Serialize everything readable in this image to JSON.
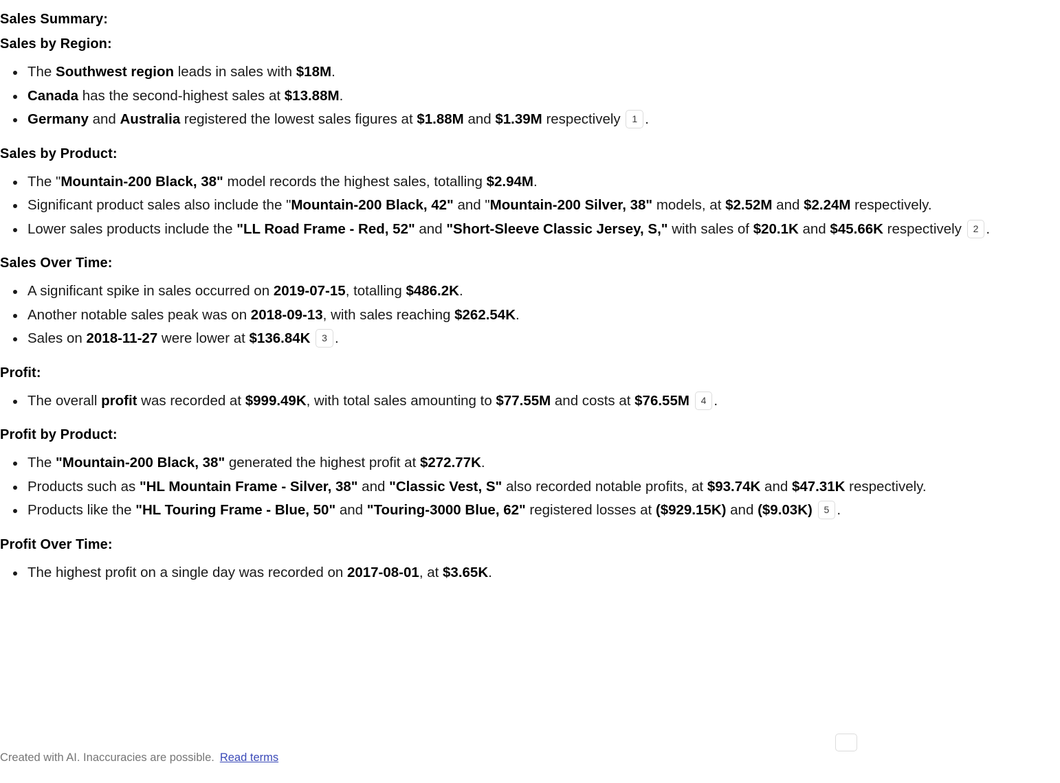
{
  "document": {
    "title": "Sales Summary:",
    "sections": [
      {
        "id": "sales-by-region",
        "heading": "Sales by Region:",
        "bullets": [
          {
            "id": "region-southwest",
            "parts": [
              {
                "t": "The ",
                "b": false
              },
              {
                "t": "Southwest region",
                "b": true
              },
              {
                "t": " leads in sales with ",
                "b": false
              },
              {
                "t": "$18M",
                "b": true
              },
              {
                "t": ".",
                "b": false
              }
            ]
          },
          {
            "id": "region-canada",
            "parts": [
              {
                "t": "Canada",
                "b": true
              },
              {
                "t": " has the second-highest sales at ",
                "b": false
              },
              {
                "t": "$13.88M",
                "b": true
              },
              {
                "t": ".",
                "b": false
              }
            ]
          },
          {
            "id": "region-germany-australia",
            "parts": [
              {
                "t": "Germany",
                "b": true
              },
              {
                "t": " and ",
                "b": false
              },
              {
                "t": "Australia",
                "b": true
              },
              {
                "t": " registered the lowest sales figures at ",
                "b": false
              },
              {
                "t": "$1.88M",
                "b": true
              },
              {
                "t": " and ",
                "b": false
              },
              {
                "t": "$1.39M",
                "b": true
              },
              {
                "t": " respectively ",
                "b": false
              },
              {
                "cite": "1"
              },
              {
                "t": ".",
                "b": false
              }
            ]
          }
        ]
      },
      {
        "id": "sales-by-product",
        "heading": "Sales by Product:",
        "bullets": [
          {
            "id": "product-top-seller",
            "parts": [
              {
                "t": "The ",
                "b": false
              },
              {
                "t": "\"",
                "b": false
              },
              {
                "t": "Mountain-200 Black, 38\"",
                "b": true
              },
              {
                "t": " model records the highest sales, totalling ",
                "b": false
              },
              {
                "t": "$2.94M",
                "b": true
              },
              {
                "t": ".",
                "b": false
              }
            ]
          },
          {
            "id": "product-significant-sales",
            "parts": [
              {
                "t": "Significant product sales also include the ",
                "b": false
              },
              {
                "t": "\"",
                "b": false
              },
              {
                "t": "Mountain-200 Black, 42\"",
                "b": true
              },
              {
                "t": " and ",
                "b": false
              },
              {
                "t": "\"",
                "b": false
              },
              {
                "t": "Mountain-200 Silver, 38\"",
                "b": true
              },
              {
                "t": " models, at ",
                "b": false
              },
              {
                "t": "$2.52M",
                "b": true
              },
              {
                "t": " and ",
                "b": false
              },
              {
                "t": "$2.24M",
                "b": true
              },
              {
                "t": " respectively.",
                "b": false
              }
            ]
          },
          {
            "id": "product-lower-sales",
            "parts": [
              {
                "t": "Lower sales products include the ",
                "b": false
              },
              {
                "t": "\"LL Road Frame - Red, 52\"",
                "b": true
              },
              {
                "t": " and ",
                "b": false
              },
              {
                "t": "\"Short-Sleeve Classic Jersey, S,\"",
                "b": true
              },
              {
                "t": " with sales of ",
                "b": false
              },
              {
                "t": "$20.1K",
                "b": true
              },
              {
                "t": " and ",
                "b": false
              },
              {
                "t": "$45.66K",
                "b": true
              },
              {
                "t": " respectively ",
                "b": false
              },
              {
                "cite": "2"
              },
              {
                "t": ".",
                "b": false
              }
            ]
          }
        ]
      },
      {
        "id": "sales-over-time",
        "heading": "Sales Over Time:",
        "bullets": [
          {
            "id": "time-spike-2019",
            "parts": [
              {
                "t": "A significant spike in sales occurred on ",
                "b": false
              },
              {
                "t": "2019-07-15",
                "b": true
              },
              {
                "t": ", totalling ",
                "b": false
              },
              {
                "t": "$486.2K",
                "b": true
              },
              {
                "t": ".",
                "b": false
              }
            ]
          },
          {
            "id": "time-peak-2018-09",
            "parts": [
              {
                "t": "Another notable sales peak was on ",
                "b": false
              },
              {
                "t": "2018-09-13",
                "b": true
              },
              {
                "t": ", with sales reaching ",
                "b": false
              },
              {
                "t": "$262.54K",
                "b": true
              },
              {
                "t": ".",
                "b": false
              }
            ]
          },
          {
            "id": "time-low-2018-11",
            "parts": [
              {
                "t": "Sales on ",
                "b": false
              },
              {
                "t": "2018-11-27",
                "b": true
              },
              {
                "t": " were lower at ",
                "b": false
              },
              {
                "t": "$136.84K",
                "b": true
              },
              {
                "t": " ",
                "b": false
              },
              {
                "cite": "3"
              },
              {
                "t": ".",
                "b": false
              }
            ]
          }
        ]
      },
      {
        "id": "profit",
        "heading": "Profit:",
        "bullets": [
          {
            "id": "profit-overall",
            "parts": [
              {
                "t": "The overall ",
                "b": false
              },
              {
                "t": "profit",
                "b": true
              },
              {
                "t": " was recorded at ",
                "b": false
              },
              {
                "t": "$999.49K",
                "b": true
              },
              {
                "t": ", with total sales amounting to ",
                "b": false
              },
              {
                "t": "$77.55M",
                "b": true
              },
              {
                "t": " and costs at ",
                "b": false
              },
              {
                "t": "$76.55M",
                "b": true
              },
              {
                "t": " ",
                "b": false
              },
              {
                "cite": "4"
              },
              {
                "t": ".",
                "b": false
              }
            ]
          }
        ]
      },
      {
        "id": "profit-by-product",
        "heading": "Profit by Product:",
        "bullets": [
          {
            "id": "profit-top-product",
            "parts": [
              {
                "t": "The ",
                "b": false
              },
              {
                "t": "\"Mountain-200 Black, 38\"",
                "b": true
              },
              {
                "t": " generated the highest profit at ",
                "b": false
              },
              {
                "t": "$272.77K",
                "b": true
              },
              {
                "t": ".",
                "b": false
              }
            ]
          },
          {
            "id": "profit-notable-products",
            "parts": [
              {
                "t": "Products such as ",
                "b": false
              },
              {
                "t": "\"HL Mountain Frame - Silver, 38\"",
                "b": true
              },
              {
                "t": " and ",
                "b": false
              },
              {
                "t": "\"Classic Vest, S\"",
                "b": true
              },
              {
                "t": " also recorded notable profits, at ",
                "b": false
              },
              {
                "t": "$93.74K",
                "b": true
              },
              {
                "t": " and ",
                "b": false
              },
              {
                "t": "$47.31K",
                "b": true
              },
              {
                "t": " respectively.",
                "b": false
              }
            ]
          },
          {
            "id": "profit-losses",
            "parts": [
              {
                "t": "Products like the ",
                "b": false
              },
              {
                "t": "\"HL Touring Frame - Blue, 50\"",
                "b": true
              },
              {
                "t": " and ",
                "b": false
              },
              {
                "t": "\"Touring-3000 Blue, 62\"",
                "b": true
              },
              {
                "t": " registered losses at ",
                "b": false
              },
              {
                "t": "($929.15K)",
                "b": true
              },
              {
                "t": " and ",
                "b": false
              },
              {
                "t": "($9.03K)",
                "b": true
              },
              {
                "t": " ",
                "b": false
              },
              {
                "cite": "5"
              },
              {
                "t": ".",
                "b": false
              }
            ]
          }
        ]
      },
      {
        "id": "profit-over-time",
        "heading": "Profit Over Time:",
        "bullets": [
          {
            "id": "profit-time-highest",
            "parts": [
              {
                "t": "The highest profit on a single day was recorded on ",
                "b": false
              },
              {
                "t": "2017-08-01",
                "b": true
              },
              {
                "t": ", at ",
                "b": false
              },
              {
                "t": "$3.65K",
                "b": true
              },
              {
                "t": ".",
                "b": false
              }
            ]
          }
        ]
      }
    ]
  },
  "footer": {
    "disclaimer": "Created with AI. Inaccuracies are possible.",
    "link_label": "Read terms"
  },
  "colors": {
    "text": "#1a1a1a",
    "heading": "#000000",
    "footer_text": "#767676",
    "link": "#3b4ab8",
    "citation_border": "#dcdcdc",
    "background": "#ffffff"
  }
}
